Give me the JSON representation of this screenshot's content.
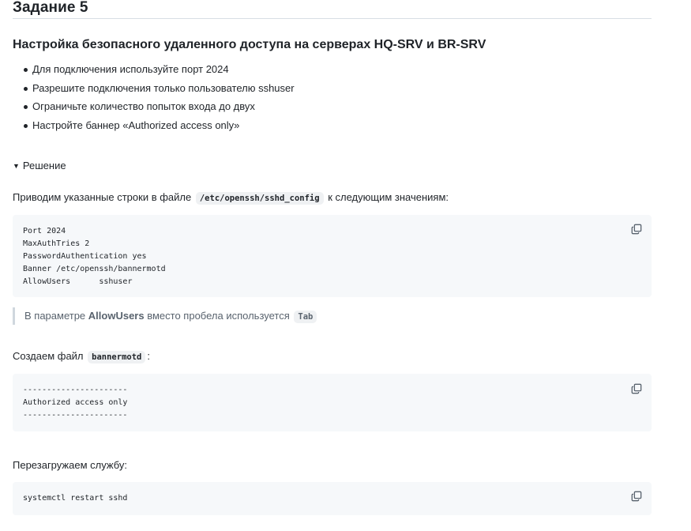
{
  "task": {
    "title": "Задание 5",
    "subtitle": "Настройка безопасного удаленного доступа на серверах HQ-SRV и BR-SRV",
    "requirements": [
      "Для подключения используйте порт 2024",
      "Разрешите подключения только пользователю sshuser",
      "Ограничьте количество попыток входа до двух",
      "Настройте баннер «Authorized access only»"
    ]
  },
  "solution": {
    "summary_label": "Решение",
    "caret_glyph": "▼",
    "para1_before": "Приводим указанные строки в файле",
    "para1_code": "/etc/openssh/sshd_config",
    "para1_after": "к следующим значениям:",
    "config_code": "Port 2024\nMaxAuthTries 2\nPasswordAuthentication yes\nBanner /etc/openssh/bannermotd\nAllowUsers\tsshuser",
    "note_before": "В параметре",
    "note_bold": "AllowUsers",
    "note_middle": "вместо пробела используется",
    "note_code": "Tab",
    "para2_before": "Создаем файл",
    "para2_code": "bannermotd",
    "para2_after": ":",
    "banner_code": "----------------------\nAuthorized access only\n----------------------",
    "para3": "Перезагружаем службу:",
    "restart_code": "systemctl restart sshd"
  },
  "icons": {
    "copy": "copy-icon"
  },
  "colors": {
    "code_background": "#f6f8fa",
    "inline_code_background": "#eff1f3",
    "text": "#1f2328",
    "muted_text": "#59636e",
    "quote_border": "#d0d7de"
  }
}
